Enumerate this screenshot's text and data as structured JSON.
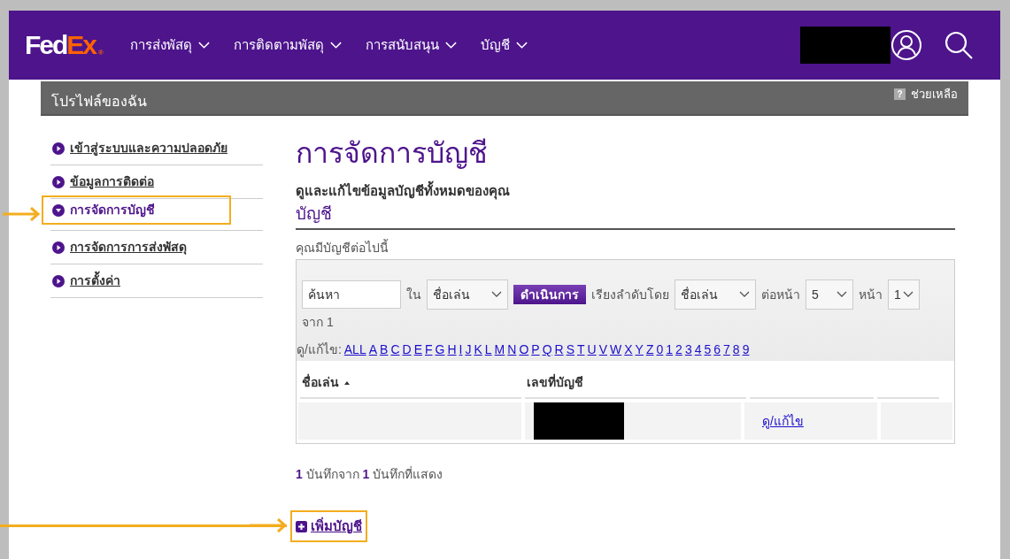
{
  "header": {
    "logo": {
      "fed": "Fed",
      "ex": "Ex",
      "mark": "®"
    },
    "nav": [
      {
        "label": "การส่งพัสดุ"
      },
      {
        "label": "การติดตามพัสดุ"
      },
      {
        "label": "การสนับสนุน"
      },
      {
        "label": "บัญชี"
      }
    ]
  },
  "profile_bar": {
    "title": "โปรไฟล์ของฉัน",
    "help_mark": "?",
    "help": "ช่วยเหลือ"
  },
  "sidebar": {
    "items": [
      {
        "label": "เข้าสู่ระบบและความปลอดภัย",
        "selected": false
      },
      {
        "label": "ข้อมูลการติดต่อ",
        "selected": false
      },
      {
        "label": "การจัดการบัญชี",
        "selected": true
      },
      {
        "label": "การจัดการการส่งพัสดุ",
        "selected": false
      },
      {
        "label": "การตั้งค่า",
        "selected": false
      }
    ]
  },
  "main": {
    "title": "การจัดการบัญชี",
    "subtitle": "ดูและแก้ไขข้อมูลบัญชีทั้งหมดของคุณ",
    "section": "บัญชี",
    "intro": "คุณมีบัญชีต่อไปนี้",
    "filter": {
      "search_value": "ค้นหา",
      "in_label": "ใน",
      "in_select": "ชื่อเล่น",
      "go_button": "ดำเนินการ",
      "sort_label": "เรียงลำดับโดย",
      "sort_select": "ชื่อเล่น",
      "per_page_label": "ต่อหน้า",
      "per_page_select": "5",
      "page_label": "หน้า",
      "page_select": "1",
      "of_text": "จาก 1"
    },
    "letters_label": "ดู/แก้ไข:",
    "letters": [
      "ALL",
      "A",
      "B",
      "C",
      "D",
      "E",
      "F",
      "G",
      "H",
      "I",
      "J",
      "K",
      "L",
      "M",
      "N",
      "O",
      "P",
      "Q",
      "R",
      "S",
      "T",
      "U",
      "V",
      "W",
      "X",
      "Y",
      "Z",
      "0",
      "1",
      "2",
      "3",
      "4",
      "5",
      "6",
      "7",
      "8",
      "9"
    ],
    "table": {
      "columns": [
        {
          "label": "ชื่อเล่น",
          "sorted": true
        },
        {
          "label": "เลขที่บัญชี",
          "sorted": false
        }
      ],
      "rows": [
        {
          "action": "ดู/แก้ไข"
        }
      ]
    },
    "summary": "**1** บันทึกจาก **1** บันทึกที่แสดง",
    "add_link": "เพิ่มบัญชี"
  }
}
